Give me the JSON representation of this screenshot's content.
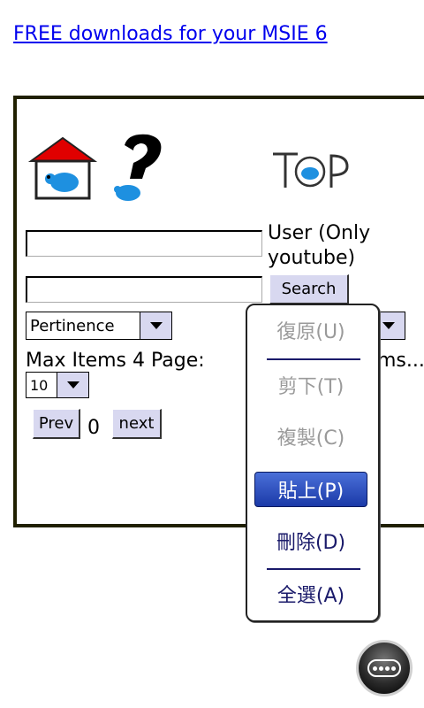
{
  "header": {
    "link_text": "FREE downloads for your MSIE 6"
  },
  "icons": {
    "home": "home-icon",
    "help": "question-mark-icon",
    "logo_text": "TOP"
  },
  "form": {
    "user_label": "User (Only youtube)",
    "search_button": "Search",
    "sort_select": "Pertinence",
    "max_items_label": "Max Items 4 Page:",
    "max_items_value": "10",
    "partial_label": "ms...:",
    "prev_button": "Prev",
    "page_number": "0",
    "next_button": "next"
  },
  "context_menu": {
    "items": [
      {
        "label": "復原(U)",
        "state": "disabled"
      },
      {
        "label": "剪下(T)",
        "state": "disabled"
      },
      {
        "label": "複製(C)",
        "state": "disabled"
      },
      {
        "label": "貼上(P)",
        "state": "selected"
      },
      {
        "label": "刪除(D)",
        "state": "enabled"
      },
      {
        "label": "全選(A)",
        "state": "enabled"
      }
    ]
  },
  "colors": {
    "link": "#0000ee",
    "button_face": "#d8d8f0",
    "menu_highlight": "#2a4ab8",
    "panel_border": "#202000"
  }
}
